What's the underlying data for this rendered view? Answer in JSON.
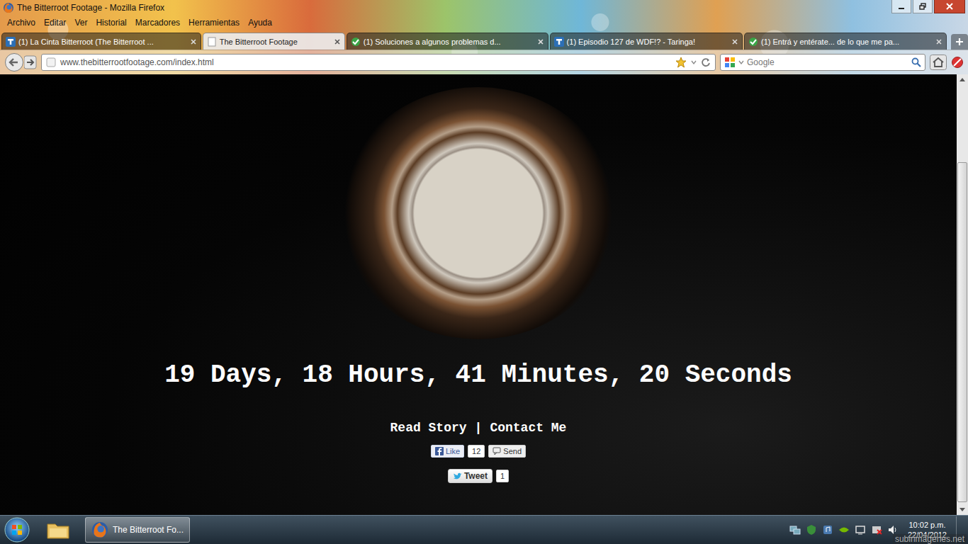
{
  "window": {
    "title": "The Bitterroot Footage - Mozilla Firefox"
  },
  "menu": [
    "Archivo",
    "Editar",
    "Ver",
    "Historial",
    "Marcadores",
    "Herramientas",
    "Ayuda"
  ],
  "tabs": [
    {
      "label": "(1) La Cinta Bitterroot (The Bitterroot ...",
      "selected": false
    },
    {
      "label": "The Bitterroot Footage",
      "selected": true
    },
    {
      "label": "(1) Soluciones a algunos problemas d...",
      "selected": false
    },
    {
      "label": "(1) Episodio 127 de WDF!? - Taringa!",
      "selected": false
    },
    {
      "label": "(1) Entrá y entérate... de lo que me pa...",
      "selected": false
    }
  ],
  "address": {
    "url": "www.thebitterrootfootage.com/index.html"
  },
  "search": {
    "placeholder": "Google"
  },
  "page": {
    "countdown": "19 Days, 18 Hours, 41 Minutes, 20 Seconds",
    "links": [
      "Read Story",
      "Contact Me"
    ],
    "separator": "|",
    "facebook": {
      "like": "Like",
      "like_count": "12",
      "send": "Send"
    },
    "twitter": {
      "tweet": "Tweet",
      "count": "1"
    }
  },
  "taskbar": {
    "tasks": [
      {
        "label": "The Bitterroot Fo...",
        "selected": true
      }
    ],
    "clock": {
      "time": "10:02 p.m.",
      "date": "22/04/2012"
    }
  },
  "watermark": "subirimagenes.net"
}
